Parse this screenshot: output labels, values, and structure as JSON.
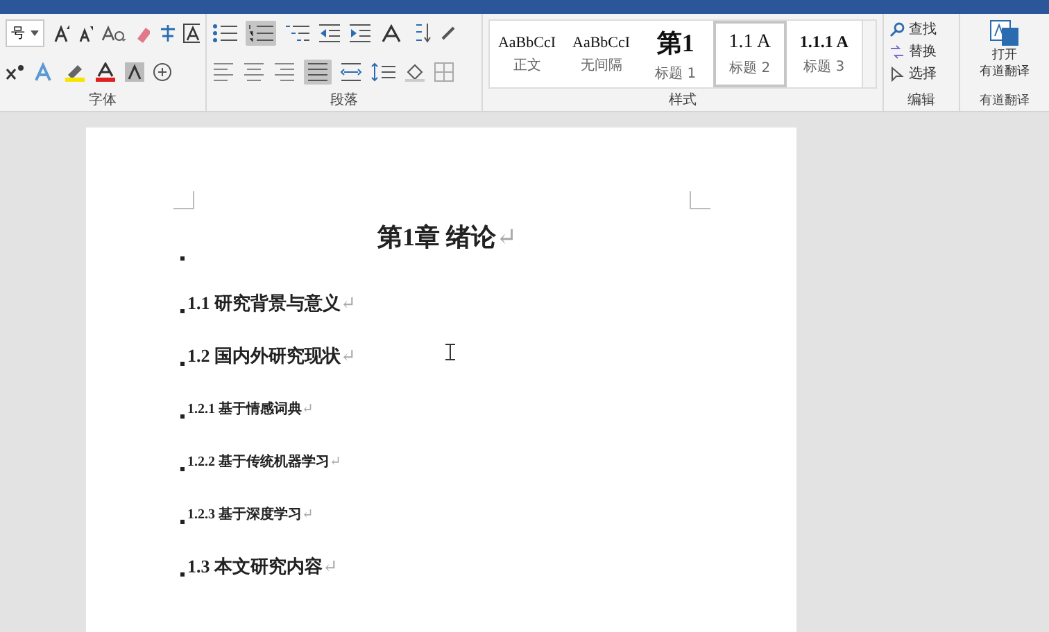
{
  "ribbon": {
    "font_group": {
      "size_field": "号",
      "label": "字体"
    },
    "paragraph_group": {
      "label": "段落",
      "numbering_on": true,
      "justify_on": true
    },
    "styles_group": {
      "label": "样式",
      "styles": [
        {
          "preview": "AaBbCcI",
          "name": "正文",
          "kind": "body",
          "selected": false
        },
        {
          "preview": "AaBbCcI",
          "name": "无间隔",
          "kind": "body",
          "selected": false
        },
        {
          "preview": "第1",
          "name": "标题 1",
          "kind": "h1",
          "selected": false
        },
        {
          "preview": "1.1 A",
          "name": "标题 2",
          "kind": "h2",
          "selected": true
        },
        {
          "preview": "1.1.1 A",
          "name": "标题 3",
          "kind": "h3",
          "selected": false
        }
      ]
    },
    "editing_group": {
      "label": "编辑",
      "items": [
        "查找",
        "替换",
        "选择"
      ]
    },
    "translate_group": {
      "button": [
        "打开",
        "有道翻译"
      ],
      "label": "有道翻译"
    }
  },
  "document": {
    "paragraphs": [
      {
        "kind": "h1",
        "text": "第1章 绪论",
        "mark": "↵"
      },
      {
        "kind": "h2",
        "text": "1.1 研究背景与意义",
        "mark": "↵"
      },
      {
        "kind": "h2",
        "text": "1.2 国内外研究现状",
        "mark": "↵"
      },
      {
        "kind": "h3",
        "text": "1.2.1 基于情感词典",
        "mark": "↵"
      },
      {
        "kind": "h3",
        "text": "1.2.2 基于传统机器学习",
        "mark": "↵"
      },
      {
        "kind": "h3",
        "text": "1.2.3 基于深度学习",
        "mark": "↵"
      },
      {
        "kind": "h2",
        "text": "1.3 本文研究内容",
        "mark": "↵"
      }
    ]
  }
}
